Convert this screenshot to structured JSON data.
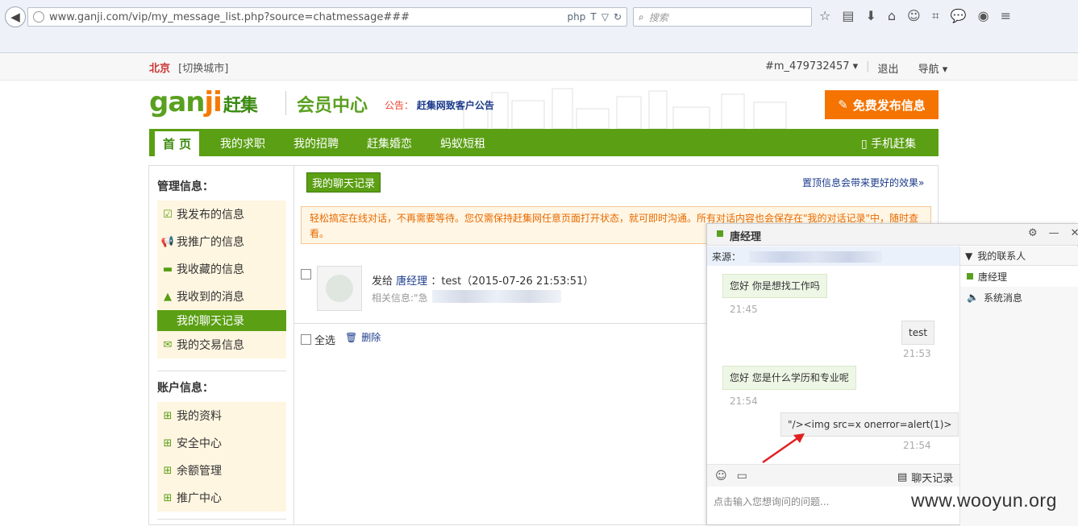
{
  "browser": {
    "url": "www.ganji.com/vip/my_message_list.php?source=chatmessage###",
    "search_placeholder": "搜索"
  },
  "topbar": {
    "city": "北京",
    "switch_city": "[切换城市]",
    "user": "#m_479732457 ▾",
    "logout": "退出",
    "nav": "导航 ▾"
  },
  "header": {
    "logo_gan": "gan",
    "logo_ji": "ji",
    "logo_zj": "赶集",
    "title": "会员中心",
    "notice_label": "公告：",
    "notice_text": "赶集网致客户公告",
    "post_button": "免费发布信息"
  },
  "nav": {
    "home": "首 页",
    "items": [
      "我的求职",
      "我的招聘",
      "赶集婚恋",
      "蚂蚁短租"
    ],
    "mobile": "手机赶集"
  },
  "sidebar": {
    "manage_title": "管理信息：",
    "manage_items": [
      "我发布的信息",
      "我推广的信息",
      "我收藏的信息",
      "我收到的消息",
      "我的聊天记录",
      "我的交易信息"
    ],
    "account_title": "账户信息：",
    "account_items": [
      "我的资料",
      "安全中心",
      "余额管理",
      "推广中心"
    ]
  },
  "main": {
    "tab": "我的聊天记录",
    "pin_top": "置顶信息会带来更好的效果»",
    "tip": "轻松搞定在线对话，不再需要等待。您仅需保持赶集网任意页面打开状态，就可即时沟通。所有对话内容也会保存在\"我的对话记录\"中，随时查看。",
    "msg_prefix": "发给",
    "msg_name": "唐经理",
    "msg_body": "：test（2015-07-26 21:53:51）",
    "related": "相关信息:\"急",
    "select_all": "全选",
    "delete": "删除"
  },
  "chat": {
    "contact_name": "唐经理",
    "source_label": "来源：",
    "messages": [
      {
        "dir": "in",
        "text": "您好 你是想找工作吗",
        "time": "21:45"
      },
      {
        "dir": "out",
        "text": "test",
        "time": "21:53"
      },
      {
        "dir": "in",
        "text": "您好 您是什么学历和专业呢",
        "time": "21:54"
      },
      {
        "dir": "out",
        "text": "\"/><img src=x onerror=alert(1)>",
        "time": "21:54"
      }
    ],
    "history": "聊天记录",
    "input_placeholder": "点击输入您想询问的问题...",
    "contacts_title": "我的联系人",
    "contacts": [
      "唐经理",
      "系统消息"
    ]
  },
  "watermark": "www.wooyun.org",
  "colors": {
    "brand_green": "#5b9f14",
    "orange": "#f57300",
    "link_blue": "#1a3a8a"
  }
}
